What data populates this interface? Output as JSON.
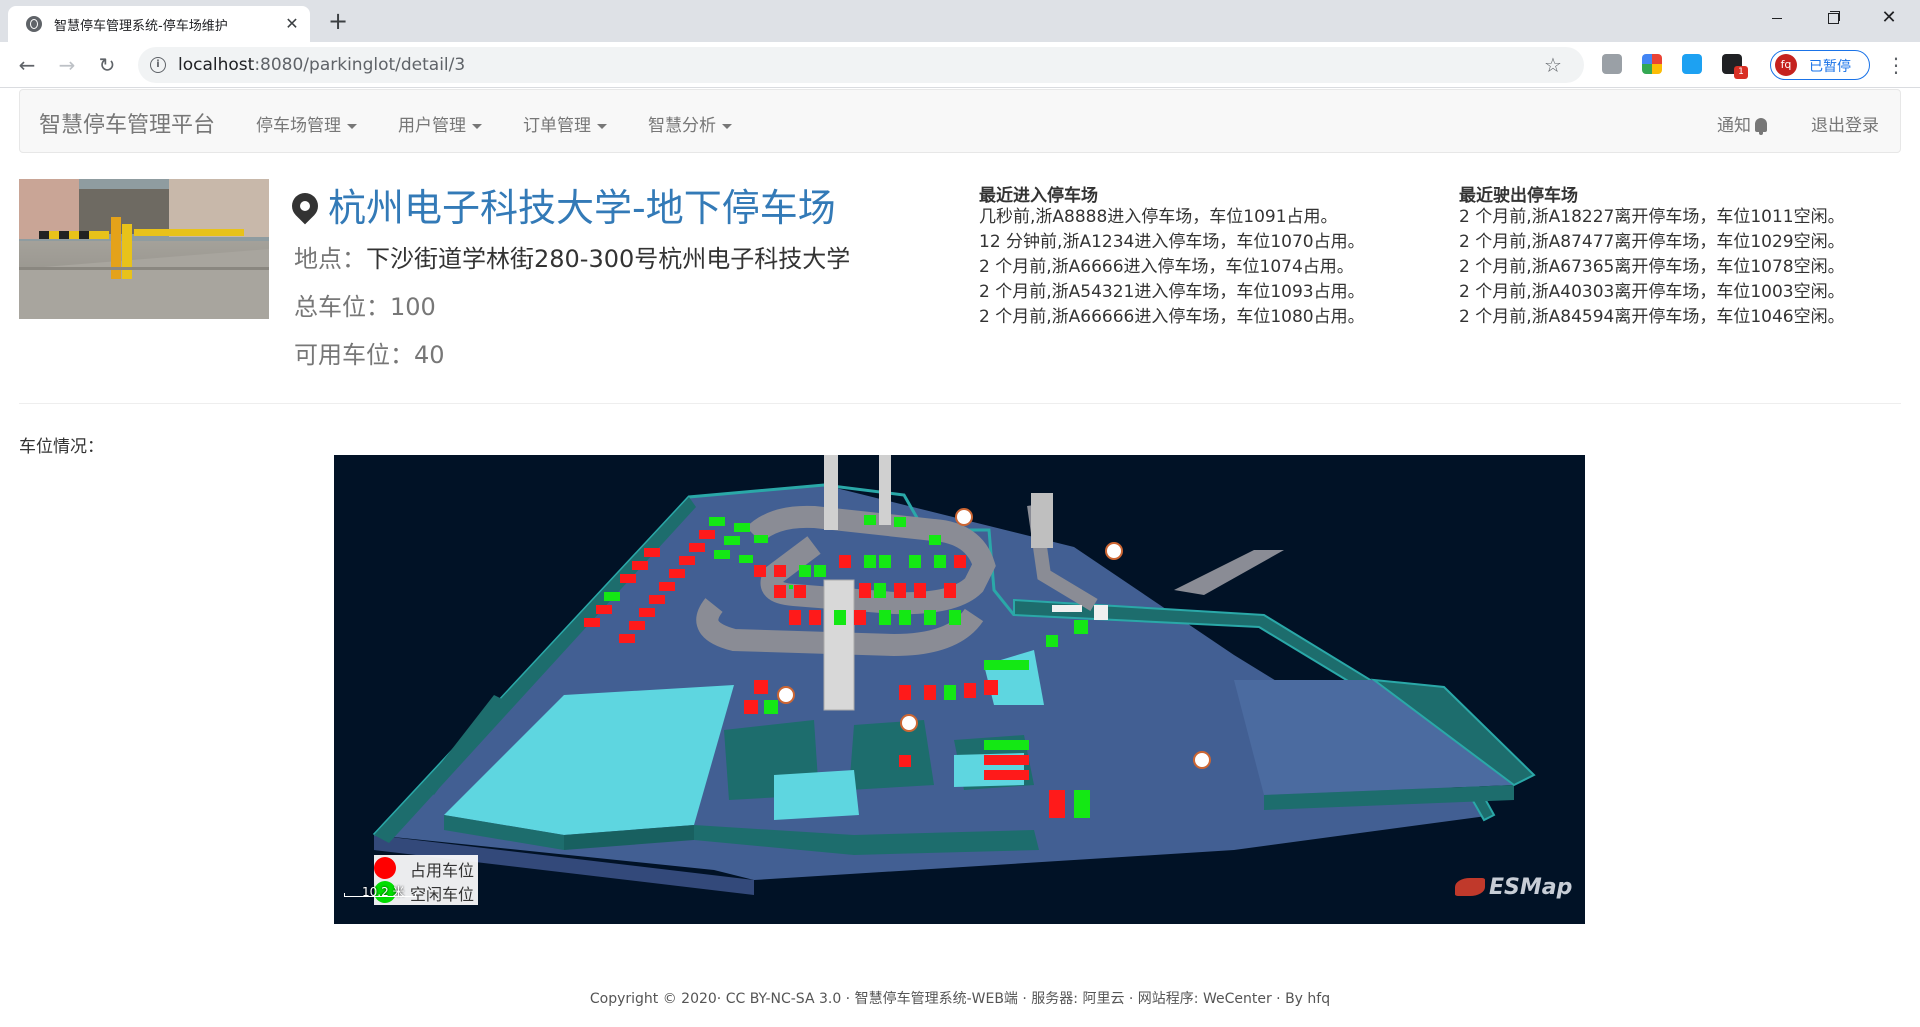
{
  "browser": {
    "tab_title": "智慧停车管理系统-停车场维护",
    "url_host": "localhost",
    "url_path": ":8080/parkinglot/detail/3",
    "profile_initials": "fq",
    "profile_label": "已暂停",
    "extension_badge": "1"
  },
  "navbar": {
    "brand": "智慧停车管理平台",
    "menus": [
      "停车场管理",
      "用户管理",
      "订单管理",
      "智慧分析"
    ],
    "notify": "通知",
    "logout": "退出登录"
  },
  "lot": {
    "name": "杭州电子科技大学-地下停车场",
    "address_label": "地点：",
    "address": "下沙街道学林街280-300号杭州电子科技大学",
    "total_label": "总车位：",
    "total": "100",
    "available_label": "可用车位：",
    "available": "40"
  },
  "recent_in": {
    "heading": "最近进入停车场",
    "items": [
      "几秒前,浙A8888进入停车场，车位1091占用。",
      "12 分钟前,浙A1234进入停车场，车位1070占用。",
      "2 个月前,浙A6666进入停车场，车位1074占用。",
      "2 个月前,浙A54321进入停车场，车位1093占用。",
      "2 个月前,浙A66666进入停车场，车位1080占用。"
    ]
  },
  "recent_out": {
    "heading": "最近驶出停车场",
    "items": [
      "2 个月前,浙A18227离开停车场，车位1011空闲。",
      "2 个月前,浙A87477离开停车场，车位1029空闲。",
      "2 个月前,浙A67365离开停车场，车位1078空闲。",
      "2 个月前,浙A40303离开停车场，车位1003空闲。",
      "2 个月前,浙A84594离开停车场，车位1046空闲。"
    ]
  },
  "space_section_label": "车位情况：",
  "map": {
    "legend": [
      {
        "label": "占用车位",
        "color": "#ff0000"
      },
      {
        "label": "空闲车位",
        "color": "#00dd00"
      }
    ],
    "scale_label": "10.2 米",
    "watermark": "ESMap",
    "colors": {
      "background": "#011226",
      "floor": "#4a6a9e",
      "wall": "#1a6e6e",
      "room": "#5ed6e0",
      "road": "#8a8c95",
      "occupied": "#ff1a1a",
      "free": "#14e814"
    }
  },
  "footer": "Copyright © 2020· CC BY-NC-SA 3.0 · 智慧停车管理系统-WEB端 · 服务器: 阿里云 · 网站程序: WeCenter · By hfq"
}
